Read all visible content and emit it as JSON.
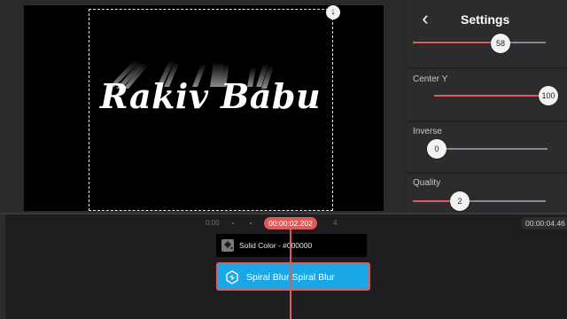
{
  "preview": {
    "title_text": "Rakiv Babu",
    "crop_handle_glyph": "↓"
  },
  "settings": {
    "title": "Settings",
    "back_glyph": "‹",
    "params": [
      {
        "label": "",
        "value": "58",
        "fraction": 0.58
      },
      {
        "label": "Center Y",
        "value": "100",
        "fraction": 1.0
      },
      {
        "label": "Inverse",
        "value": "0",
        "fraction": 0.0
      },
      {
        "label": "Quality",
        "value": "2",
        "fraction": 0.2
      }
    ]
  },
  "timeline": {
    "ruler_start": "0:00",
    "ruler_mark": "4",
    "current_time": "00:00:02.202",
    "end_time": "00:00:04.46",
    "solid_clip_label": "Solid Color - #000000",
    "effect_clip_label": "Spiral Blur Spiral Blur"
  },
  "colors": {
    "accent": "#e05a5a",
    "effect_clip": "#1aa7e8",
    "panel": "#2c2c2f"
  },
  "icons": {
    "back": "chevron-left-icon",
    "solid": "fill-bucket-icon",
    "effect": "effect-hexagon-icon",
    "crop_handle": "download-arrow-icon"
  }
}
